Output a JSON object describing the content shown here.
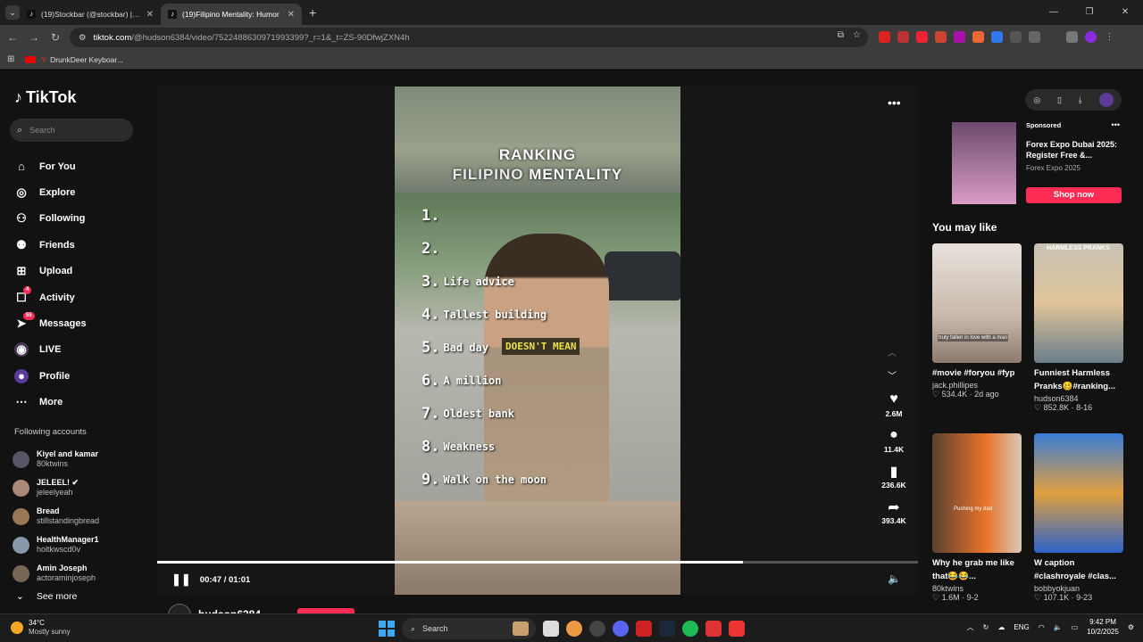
{
  "browser": {
    "tabs": [
      {
        "title": "(19)Stockbar (@stockbar) | TikTok",
        "active": false
      },
      {
        "title": "(19)Filipino Mentality: Humor",
        "active": true
      }
    ],
    "url_domain": "tiktok.com",
    "url_path": "/@hudson6384/video/7522488630971993399?_r=1&_t=ZS-90DfwjZXN4h",
    "bookmark": "DrunkDeer Keyboar..."
  },
  "sidebar": {
    "logo": "TikTok",
    "search_placeholder": "Search",
    "menu": [
      {
        "label": "For You",
        "icon": "home-icon"
      },
      {
        "label": "Explore",
        "icon": "compass-icon"
      },
      {
        "label": "Following",
        "icon": "following-icon"
      },
      {
        "label": "Friends",
        "icon": "friends-icon"
      },
      {
        "label": "Upload",
        "icon": "upload-icon"
      },
      {
        "label": "Activity",
        "icon": "activity-icon",
        "badge": "4"
      },
      {
        "label": "Messages",
        "icon": "messages-icon",
        "badge": "55"
      },
      {
        "label": "LIVE",
        "icon": "live-icon"
      },
      {
        "label": "Profile",
        "icon": "profile-icon"
      },
      {
        "label": "More",
        "icon": "more-icon"
      }
    ],
    "following_title": "Following accounts",
    "accounts": [
      {
        "name": "Kiyel and kamar",
        "handle": "80ktwins",
        "color": "#556"
      },
      {
        "name": "JELEEL! ✔",
        "handle": "jeleelyeah",
        "color": "#a87"
      },
      {
        "name": "Bread",
        "handle": "stillstandingbread",
        "color": "#975"
      },
      {
        "name": "HealthManager1",
        "handle": "holtkwscd0v",
        "color": "#89a"
      },
      {
        "name": "Amin Joseph",
        "handle": "actoraminjoseph",
        "color": "#765"
      }
    ],
    "see_more": "See more"
  },
  "video": {
    "title_line1": "RANKING",
    "title_line2_a": "FILIPINO",
    "title_line2_b": "MENTALITY",
    "ranks": [
      {
        "num": "1.",
        "label": ""
      },
      {
        "num": "2.",
        "label": ""
      },
      {
        "num": "3.",
        "label": "Life advice"
      },
      {
        "num": "4.",
        "label": "Tallest building"
      },
      {
        "num": "5.",
        "label": "Bad day"
      },
      {
        "num": "6.",
        "label": "A million"
      },
      {
        "num": "7.",
        "label": "Oldest bank"
      },
      {
        "num": "8.",
        "label": "Weakness"
      },
      {
        "num": "9.",
        "label": "Walk on the moon"
      }
    ],
    "caption": "DOESN'T MEAN",
    "time": "00:47 / 01:01",
    "progress": 0.77,
    "author": "hudson6384"
  },
  "actions": {
    "likes": "2.6M",
    "comments": "11.4K",
    "saves": "236.6K",
    "shares": "393.4K"
  },
  "sponsored": {
    "label": "Sponsored",
    "title": "Forex Expo Dubai 2025: Register Free &...",
    "subtitle": "Forex Expo 2025",
    "button": "Shop now"
  },
  "you_may_like": {
    "title": "You may like",
    "cards": [
      {
        "title": "#movie #foryou #fyp",
        "user": "jack.phillipes",
        "stats": "♡ 534.4K · 2d ago",
        "overlay": "truly fallen in love with a man"
      },
      {
        "title": "Funniest Harmless Pranks🥴#ranking...",
        "user": "hudson6384",
        "stats": "♡ 852.8K · 8-16",
        "overlay": "HARMLESS PRANKS"
      },
      {
        "title": "Why he grab me like that😂😂...",
        "user": "80ktwins",
        "stats": "♡ 1.6M · 9-2",
        "overlay": "Pushing my dad"
      },
      {
        "title": "W caption #clashroyale #clas...",
        "user": "bobbyokjuan",
        "stats": "♡ 107.1K · 9-23",
        "overlay": ""
      }
    ]
  },
  "taskbar": {
    "temp": "34°C",
    "weather": "Mostly sunny",
    "search": "Search",
    "lang": "ENG",
    "time": "9:42 PM",
    "date": "10/2/2025"
  }
}
